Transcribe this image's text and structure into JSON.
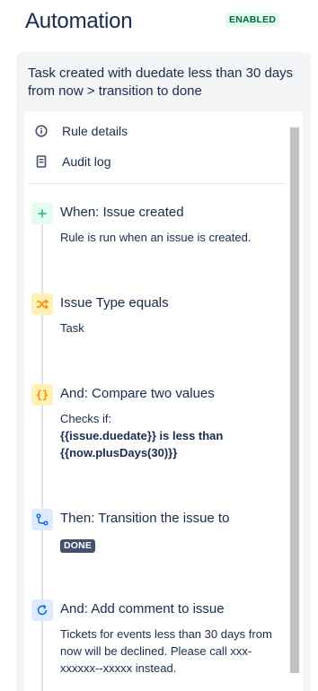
{
  "header": {
    "title": "Automation",
    "status_badge": "ENABLED"
  },
  "rule": {
    "name": "Task created with duedate less than 30 days from now > transition to done"
  },
  "menu": {
    "rule_details": "Rule details",
    "audit_log": "Audit log"
  },
  "steps": [
    {
      "title": "When: Issue created",
      "description": "Rule is run when an issue is created."
    },
    {
      "title": "Issue Type equals",
      "description": "Task"
    },
    {
      "title": "And: Compare two values",
      "description_prefix": "Checks if:",
      "description_line1": "{{issue.duedate}} is less than",
      "description_line2": "{{now.plusDays(30)}}"
    },
    {
      "title": "Then: Transition the issue to",
      "status": "DONE"
    },
    {
      "title": "And: Add comment to issue",
      "description": "Tickets for events less than 30 days from now will be declined. Please call xxx-xxxxxx--xxxxx instead."
    }
  ],
  "icons": {
    "trigger": "plus-icon",
    "condition": "shuffle-icon",
    "compare": "braces-icon",
    "transition": "transition-icon",
    "comment": "refresh-icon",
    "details": "info-icon",
    "audit": "document-icon"
  },
  "colors": {
    "accent_green": "#36b37e",
    "accent_orange": "#ff8b00",
    "accent_blue": "#0065ff",
    "badge_bg": "#e3fcef"
  }
}
